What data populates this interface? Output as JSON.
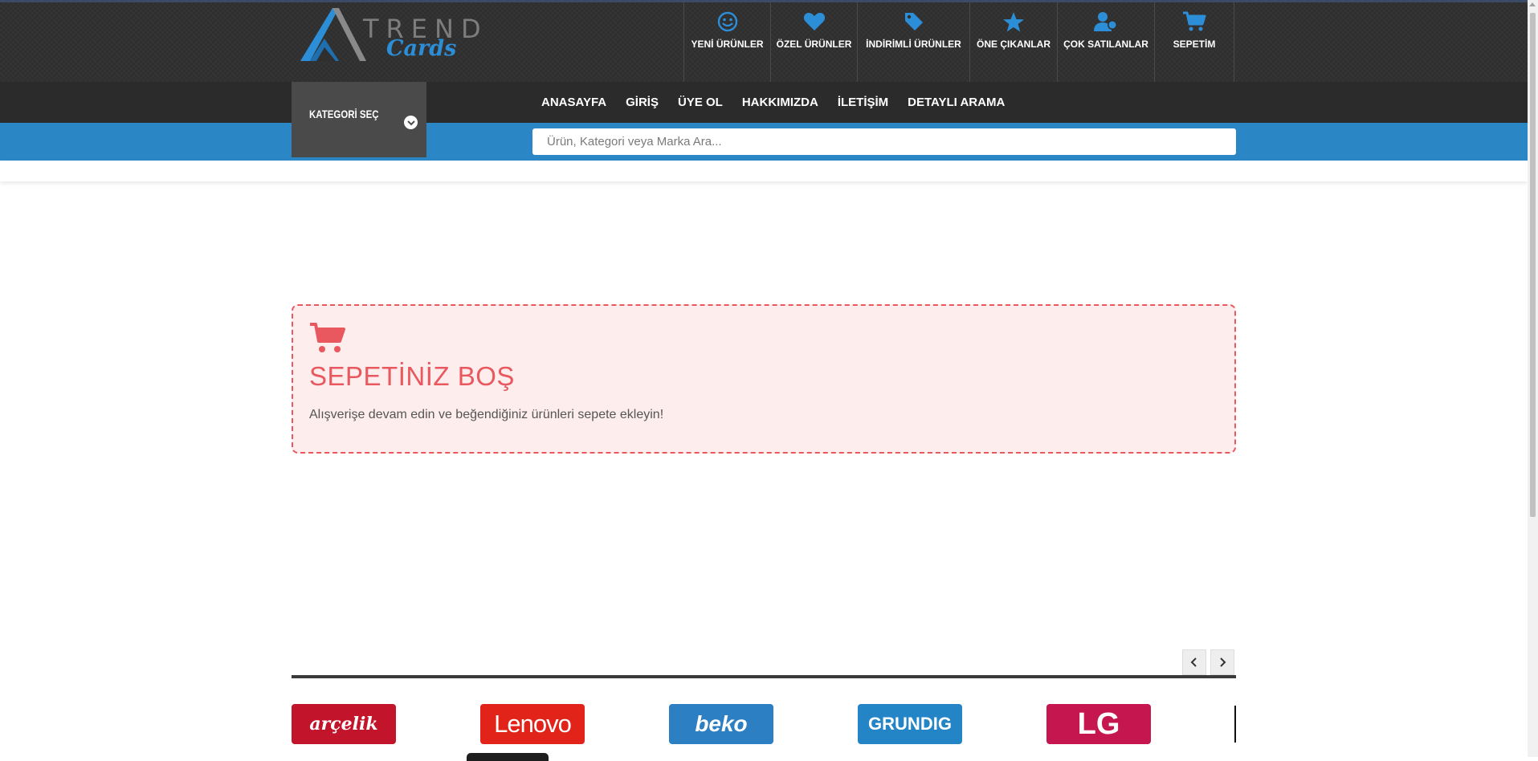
{
  "brand": {
    "trend": "TREND",
    "cards": "Cards"
  },
  "quick_nav": [
    {
      "label": "YENİ ÜRÜNLER",
      "icon": "smile-icon"
    },
    {
      "label": "ÖZEL ÜRÜNLER",
      "icon": "heart-icon"
    },
    {
      "label": "İNDİRİMLİ ÜRÜNLER",
      "icon": "tag-icon"
    },
    {
      "label": "ÖNE ÇIKANLAR",
      "icon": "star-icon"
    },
    {
      "label": "ÇOK SATILANLAR",
      "icon": "users-icon"
    },
    {
      "label": "SEPETİM",
      "icon": "cart-icon"
    }
  ],
  "category_select": {
    "label": "KATEGORİ SEÇ"
  },
  "menu": [
    {
      "label": "ANASAYFA"
    },
    {
      "label": "GİRİŞ"
    },
    {
      "label": "ÜYE OL"
    },
    {
      "label": "HAKKIMIZDA"
    },
    {
      "label": "İLETİŞİM"
    },
    {
      "label": "DETAYLI ARAMA"
    }
  ],
  "search": {
    "placeholder": "Ürün, Kategori veya Marka Ara...",
    "value": ""
  },
  "empty_cart": {
    "title": "SEPETİNİZ BOŞ",
    "message": "Alışverişe devam edin ve beğendiğiniz ürünleri sepete ekleyin!"
  },
  "brands": {
    "arcelik": "arçelik",
    "lenovo": "Lenovo",
    "beko": "beko",
    "grundig": "GRUNDIG",
    "lg": "LG"
  },
  "colors": {
    "header_bg": "#2f2f2f",
    "accent_blue": "#2b86c5",
    "empty_cart_red": "#e9585e",
    "empty_cart_bg": "#fdeded"
  }
}
